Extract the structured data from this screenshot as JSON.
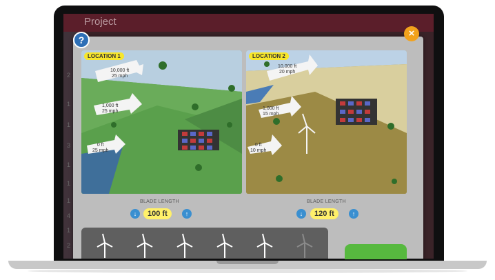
{
  "app": {
    "title": "Project"
  },
  "sidebar": {
    "marks": [
      "2",
      "1",
      "1",
      "3",
      "1",
      "1",
      "1",
      "4",
      "1",
      "2"
    ]
  },
  "help": {
    "label": "?"
  },
  "close": {
    "label": "×"
  },
  "locations": [
    {
      "label": "LOCATION 1",
      "arrows": [
        {
          "height": "10,000 ft",
          "speed": "25 mph"
        },
        {
          "height": "1,000 ft",
          "speed": "25 mph"
        },
        {
          "height": "0 ft",
          "speed": "25 mph"
        }
      ],
      "blade_title": "BLADE LENGTH",
      "blade_value": "100 ft"
    },
    {
      "label": "LOCATION 2",
      "arrows": [
        {
          "height": "10,000 ft",
          "speed": "20 mph"
        },
        {
          "height": "1,000 ft",
          "speed": "15 mph"
        },
        {
          "height": "0 ft",
          "speed": "10 mph"
        }
      ],
      "blade_title": "BLADE LENGTH",
      "blade_value": "120 ft"
    }
  ],
  "icons": {
    "decrease": "arrow-down-icon",
    "increase": "arrow-up-icon",
    "turbine": "wind-turbine-icon"
  },
  "turbines": {
    "active": 5,
    "total": 6
  },
  "colors": {
    "stepper": "#3a8fd0",
    "value_pill": "#fff06a",
    "location_label": "#f7e62b",
    "close": "#f2a21c",
    "action": "#57b93f"
  }
}
